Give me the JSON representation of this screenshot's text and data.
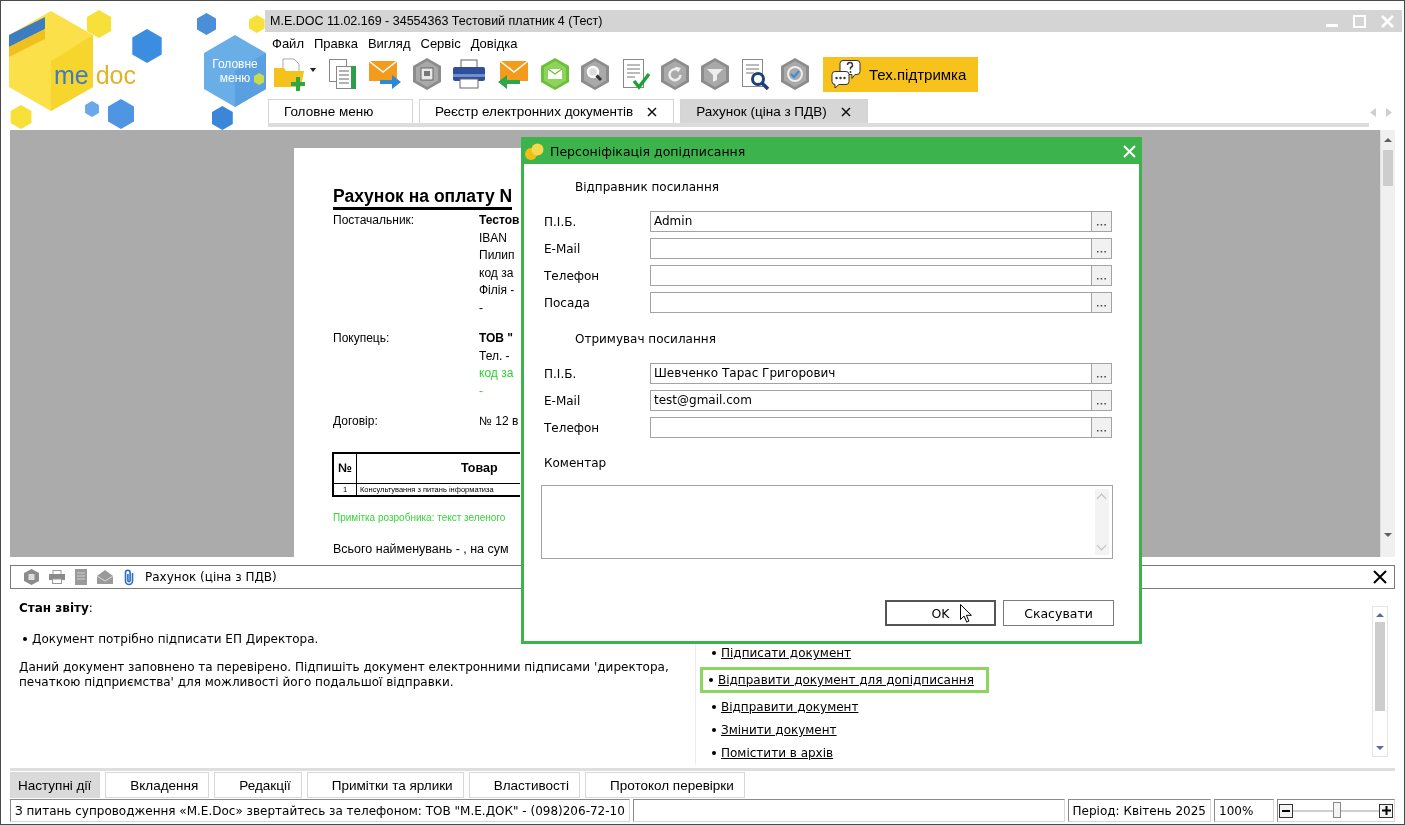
{
  "app": {
    "logo": {
      "word_1": "me",
      "word_2": "doc"
    },
    "main_menu_tile": "Головне меню"
  },
  "window": {
    "title": "M.E.DOC 11.02.169 - 34554363 Тестовий платник 4 (Тест)"
  },
  "menu": [
    "Файл",
    "Правка",
    "Вигляд",
    "Сервіс",
    "Довідка"
  ],
  "toolbar": {
    "support_button": "Тех.підтримка"
  },
  "tabs": [
    {
      "label": "Головне меню",
      "selected": false,
      "closable": false
    },
    {
      "label": "Реєстр електронних документів",
      "selected": false,
      "closable": true
    },
    {
      "label": "Рахунок (ціна з ПДВ)",
      "selected": true,
      "closable": true
    }
  ],
  "document": {
    "title": "Рахунок на оплату N",
    "details": [
      {
        "label": "Постачальник:",
        "lines": [
          {
            "text": "Тестов",
            "kind": "bold"
          },
          {
            "text": "IBAN",
            "kind": "plain"
          },
          {
            "text": "Пилип",
            "kind": "plain"
          },
          {
            "text": "код за",
            "kind": "plain"
          },
          {
            "text": "Філія -",
            "kind": "plain"
          },
          {
            "text": "-",
            "kind": "plain"
          }
        ]
      },
      {
        "label": "Покупець:",
        "lines": [
          {
            "text": "ТОВ \"",
            "kind": "bold"
          },
          {
            "text": "Тел. -",
            "kind": "plain"
          },
          {
            "text": "код за",
            "kind": "note"
          },
          {
            "text": "-",
            "kind": "note"
          }
        ]
      },
      {
        "label": "Договір:",
        "lines": [
          {
            "text": "№ 12 в",
            "kind": "plain"
          }
        ]
      }
    ],
    "table": {
      "columns": [
        "№",
        "Товар"
      ],
      "rows": [
        [
          "1",
          "Консультування з питань інформатиза"
        ]
      ]
    },
    "note": "Примітка розробника: текст зеленого",
    "total": "Всього найменувань - , на сум"
  },
  "dialog": {
    "title": "Персоніфікація допідписання",
    "sections": [
      {
        "heading": "Відправник посилання",
        "fields": [
          {
            "label": "П.І.Б.",
            "value": "Admin"
          },
          {
            "label": "E-Mail"
          },
          {
            "label": "Телефон"
          },
          {
            "label": "Посада"
          }
        ]
      },
      {
        "heading": "Отримувач посилання",
        "fields": [
          {
            "label": "П.І.Б.",
            "value": "Шевченко Тарас Григорович"
          },
          {
            "label": "E-Mail",
            "value": "test@gmail.com"
          },
          {
            "label": "Телефон"
          }
        ]
      }
    ],
    "comment": {
      "label": "Коментар"
    },
    "buttons": [
      {
        "label": "OK",
        "default": true
      },
      {
        "label": "Скасувати",
        "default": false
      }
    ]
  },
  "bottom_panel": {
    "title": "Рахунок (ціна з ПДВ)",
    "status_heading": "**Стан звіту**:",
    "status_items": [
      "Документ потрібно підписати ЕП Директора."
    ],
    "message": "Даний документ заповнено та перевірено. Підпишіть документ електронними підписами 'директора, печаткою підприємства' для можливості його подальшої відправки.",
    "actions": [
      {
        "label": "Підписати документ",
        "highlighted": false
      },
      {
        "label": "Відправити документ для допідписання",
        "highlighted": true
      },
      {
        "label": "Відправити документ",
        "highlighted": false
      },
      {
        "label": "Змінити документ",
        "highlighted": false
      },
      {
        "label": "Помістити в архів",
        "highlighted": false
      }
    ]
  },
  "bottom_tabs": [
    {
      "label": "Наступні дії",
      "selected": true
    },
    {
      "label": "Вкладення",
      "selected": false
    },
    {
      "label": "Редакції",
      "selected": false
    },
    {
      "label": "Примітки та ярлики",
      "selected": false
    },
    {
      "label": "Властивості",
      "selected": false
    },
    {
      "label": "Протокол перевірки",
      "selected": false
    }
  ],
  "status_bar": {
    "message": "З питань супроводження «M.E.Doc» звертайтесь за телефоном: ТОВ \"М.Е.ДОК\" - (098)206-72-10",
    "period": "Період: Квітень 2025",
    "zoom": "100%",
    "zoom_slider": {
      "level": 0.5
    }
  }
}
